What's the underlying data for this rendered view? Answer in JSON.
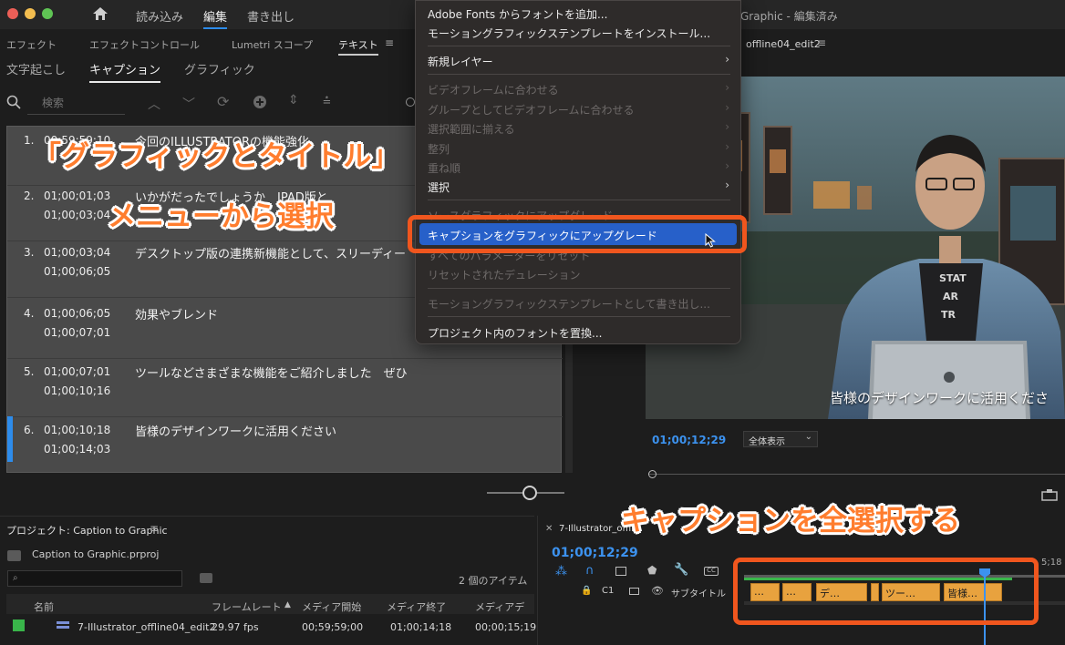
{
  "window": {
    "title_partial": "Graphic - 編集済み",
    "nav": [
      "読み込み",
      "編集",
      "書き出し"
    ]
  },
  "panel_tabs": [
    "エフェクト",
    "エフェクトコントロール",
    "Lumetri スコープ",
    "テキスト"
  ],
  "sub_tabs": [
    "文字起こし",
    "キャプション",
    "グラフィック"
  ],
  "search": {
    "placeholder": "検索"
  },
  "captions": [
    {
      "num": "1.",
      "in": "00;59;59;10",
      "out": "",
      "text": "今回のILLUSTRATORの機能強化"
    },
    {
      "num": "2.",
      "in": "01;00;01;03",
      "out": "01;00;03;04",
      "text": "いかがだったでしょうか　IPAD版と"
    },
    {
      "num": "3.",
      "in": "01;00;03;04",
      "out": "01;00;06;05",
      "text": "デスクトップ版の連携新機能として、スリーディー"
    },
    {
      "num": "4.",
      "in": "01;00;06;05",
      "out": "01;00;07;01",
      "text": "効果やブレンド"
    },
    {
      "num": "5.",
      "in": "01;00;07;01",
      "out": "01;00;10;16",
      "text": "ツールなどさまざまな機能をご紹介しました　ぜひ"
    },
    {
      "num": "6.",
      "in": "01;00;10;18",
      "out": "01;00;14;03",
      "text": "皆様のデザインワークに活用ください"
    }
  ],
  "menu": {
    "items": [
      {
        "label": "Adobe Fonts からフォントを追加...",
        "disabled": false
      },
      {
        "label": "モーショングラフィックステンプレートをインストール...",
        "disabled": false
      },
      {
        "label": "新規レイヤー",
        "disabled": false
      },
      {
        "label": "ビデオフレームに合わせる",
        "disabled": true
      },
      {
        "label": "グループとしてビデオフレームに合わせる",
        "disabled": true
      },
      {
        "label": "選択範囲に揃える",
        "disabled": true
      },
      {
        "label": "整列",
        "disabled": true
      },
      {
        "label": "重ね順",
        "disabled": true
      },
      {
        "label": "選択",
        "disabled": false
      },
      {
        "label": "ソースグラフィックにアップグレード",
        "disabled": true
      },
      {
        "label": "キャプションをグラフィックにアップグレード",
        "disabled": false
      },
      {
        "label": "すべてのパラメーターをリセット",
        "disabled": true
      },
      {
        "label": "リセットされたデュレーション",
        "disabled": true
      },
      {
        "label": "モーショングラフィックステンプレートとして書き出し...",
        "disabled": true
      },
      {
        "label": "プロジェクト内のフォントを置換...",
        "disabled": false
      }
    ]
  },
  "monitor": {
    "sequence_tab": "offline04_edit2",
    "subtitle": "皆様のデザインワークに活用くださ",
    "timecode": "01;00;12;29",
    "zoom": "全体表示",
    "shirt_text": "STAT AR TR"
  },
  "annotations": {
    "menu_title": "「グラフィックとタイトル」",
    "menu_sub": "メニューから選択",
    "select_all": "キャプションを全選択する"
  },
  "project": {
    "title": "プロジェクト: Caption to Graphic",
    "file": "Caption to Graphic.prproj",
    "item_count": "2 個のアイテム",
    "columns": [
      "名前",
      "フレームレート",
      "メディア開始",
      "メディア終了",
      "メディアデ"
    ],
    "row": {
      "name": "7-Illustrator_offline04_edit2",
      "fps": "29.97 fps",
      "start": "00;59;59;00",
      "end": "01;00;14;18",
      "dur": "00;00;15;19"
    }
  },
  "timeline": {
    "tab": "7-Illustrator_offline04_edit2",
    "timecode": "01;00;12;29",
    "track_label": "サブタイトル",
    "track_id": "C1",
    "ruler_label": "5;18",
    "clips": [
      "…",
      "…",
      "デ…",
      "",
      "ツー…",
      "皆様…"
    ]
  },
  "colors": {
    "accent": "#2d8ceb",
    "highlight": "#2760c9",
    "annotation": "#f0561e",
    "clip": "#e8a23e"
  }
}
